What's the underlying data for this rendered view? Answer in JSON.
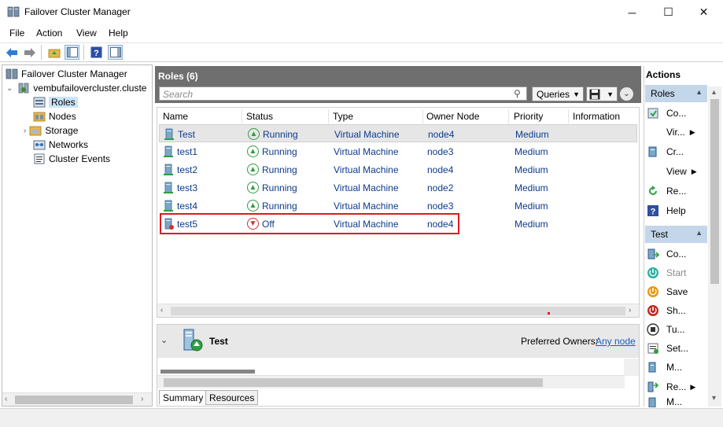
{
  "window": {
    "title": "Failover Cluster Manager"
  },
  "menu": [
    "File",
    "Action",
    "View",
    "Help"
  ],
  "tree": {
    "root": "Failover Cluster Manager",
    "cluster": "vembufailovercluster.cluste",
    "items": [
      "Roles",
      "Nodes",
      "Storage",
      "Networks",
      "Cluster Events"
    ]
  },
  "center": {
    "title": "Roles (6)",
    "search_placeholder": "Search",
    "queries_label": "Queries",
    "columns": [
      "Name",
      "Status",
      "Type",
      "Owner Node",
      "Priority",
      "Information"
    ],
    "rows": [
      {
        "name": "Test",
        "status": "Running",
        "type": "Virtual Machine",
        "owner": "node4",
        "priority": "Medium"
      },
      {
        "name": "test1",
        "status": "Running",
        "type": "Virtual Machine",
        "owner": "node3",
        "priority": "Medium"
      },
      {
        "name": "test2",
        "status": "Running",
        "type": "Virtual Machine",
        "owner": "node4",
        "priority": "Medium"
      },
      {
        "name": "test3",
        "status": "Running",
        "type": "Virtual Machine",
        "owner": "node2",
        "priority": "Medium"
      },
      {
        "name": "test4",
        "status": "Running",
        "type": "Virtual Machine",
        "owner": "node3",
        "priority": "Medium"
      },
      {
        "name": "test5",
        "status": "Off",
        "type": "Virtual Machine",
        "owner": "node4",
        "priority": "Medium"
      }
    ]
  },
  "detail": {
    "name": "Test",
    "preferred_owners_label": "Preferred Owners:",
    "preferred_owners_link": "Any node",
    "tabs": [
      "Summary",
      "Resources"
    ]
  },
  "actions": {
    "title": "Actions",
    "section1": "Roles",
    "section1_items": [
      "Co...",
      "Vir...",
      "Cr...",
      "View",
      "Re...",
      "Help"
    ],
    "section2": "Test",
    "section2_items": [
      "Co...",
      "Start",
      "Save",
      "Sh...",
      "Tu...",
      "Set...",
      "M...",
      "Re...",
      "M..."
    ]
  },
  "colors": {
    "running": "#2e9e43",
    "off": "#d32f2f",
    "highlight": "#e0191f",
    "header_gray": "#6f6f6f",
    "actions_section": "#c4d6ea"
  }
}
